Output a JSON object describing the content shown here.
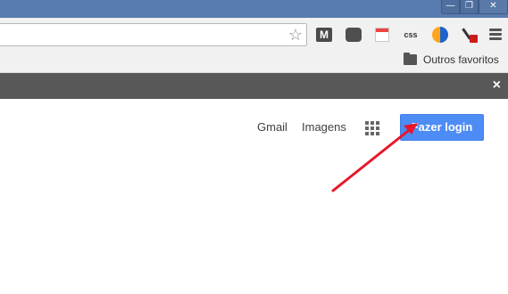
{
  "window": {
    "min_glyph": "—",
    "max_glyph": "❐",
    "close_glyph": "✕"
  },
  "toolbar": {
    "bookmark_star_icon": "star-icon",
    "extensions": [
      "m-extension-icon",
      "pocket-icon",
      "calendar-icon",
      "css-icon",
      "globe-icon",
      "eyedropper-icon"
    ],
    "css_label": "css",
    "m_label": "M"
  },
  "bookmarks": {
    "folder_label": "Outros favoritos"
  },
  "notification_bar": {
    "close_glyph": "×"
  },
  "google": {
    "gmail": "Gmail",
    "images": "Imagens",
    "login": "Fazer login"
  },
  "colors": {
    "titlebar": "#587bb0",
    "login_button": "#4d8cf5",
    "annotation_arrow": "#e8162b"
  }
}
